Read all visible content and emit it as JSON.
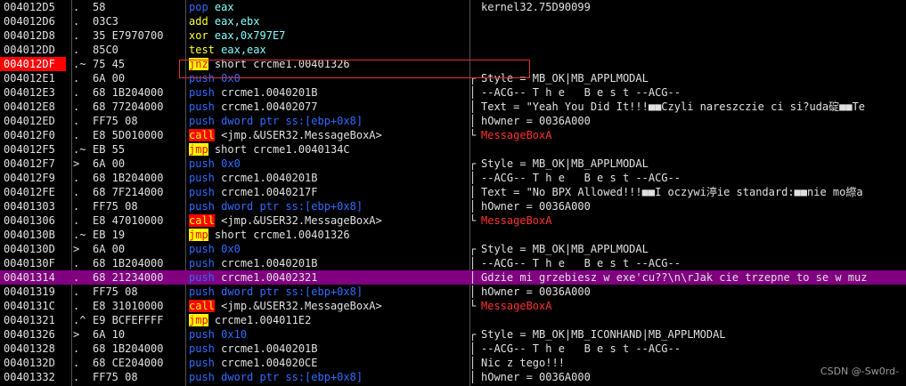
{
  "rows": [
    {
      "addr": "004012D5",
      "arr": ".",
      "hex": "58",
      "m": "pop",
      "o": "eax",
      "c": "kernel32.75D90099"
    },
    {
      "addr": "004012D6",
      "arr": ".",
      "hex": "03C3",
      "m": "add",
      "o": "eax,ebx",
      "c": ""
    },
    {
      "addr": "004012D8",
      "arr": ".",
      "hex": "35 E7970700",
      "m": "xor",
      "o": "eax,0x797E7",
      "c": ""
    },
    {
      "addr": "004012DD",
      "arr": ".",
      "hex": "85C0",
      "m": "test",
      "o": "eax,eax",
      "c": ""
    },
    {
      "addr": "004012DF",
      "arr": ".~",
      "hex": "75 45",
      "m": "jnz",
      "o": "short crcme1.00401326",
      "c": ""
    },
    {
      "addr": "004012E1",
      "arr": ".",
      "hex": "6A 00",
      "m": "push",
      "o": "0x0",
      "c": "Style = MB_OK|MB_APPLMODAL"
    },
    {
      "addr": "004012E3",
      "arr": ".",
      "hex": "68 1B204000",
      "m": "push",
      "o": "crcme1.0040201B",
      "c": "--ACG-- T h e   B e s t --ACG--"
    },
    {
      "addr": "004012E8",
      "arr": ".",
      "hex": "68 77204000",
      "m": "push",
      "o": "crcme1.00402077",
      "c": "Text = \"Yeah You Did It!!!■■Czyli nareszczie ci si?uda碇■■Te"
    },
    {
      "addr": "004012ED",
      "arr": ".",
      "hex": "FF75 08",
      "m": "push",
      "o": "dword ptr ss:[ebp+0x8]",
      "c": "hOwner = 0036A000"
    },
    {
      "addr": "004012F0",
      "arr": ".",
      "hex": "E8 5D010000",
      "m": "call",
      "o": "<jmp.&USER32.MessageBoxA>",
      "c": "MessageBoxA"
    },
    {
      "addr": "004012F5",
      "arr": ".~",
      "hex": "EB 55",
      "m": "jmp",
      "o": "short crcme1.0040134C",
      "c": ""
    },
    {
      "addr": "004012F7",
      "arr": ">",
      "hex": "6A 00",
      "m": "push",
      "o": "0x0",
      "c": "Style = MB_OK|MB_APPLMODAL"
    },
    {
      "addr": "004012F9",
      "arr": ".",
      "hex": "68 1B204000",
      "m": "push",
      "o": "crcme1.0040201B",
      "c": "--ACG-- T h e   B e s t --ACG--"
    },
    {
      "addr": "004012FE",
      "arr": ".",
      "hex": "68 7F214000",
      "m": "push",
      "o": "crcme1.0040217F",
      "c": "Text = \"No BPX Allowed!!!■■I oczywi渟ie standard:■■nie mo縩a"
    },
    {
      "addr": "00401303",
      "arr": ".",
      "hex": "FF75 08",
      "m": "push",
      "o": "dword ptr ss:[ebp+0x8]",
      "c": "hOwner = 0036A000"
    },
    {
      "addr": "00401306",
      "arr": ".",
      "hex": "E8 47010000",
      "m": "call",
      "o": "<jmp.&USER32.MessageBoxA>",
      "c": "MessageBoxA"
    },
    {
      "addr": "0040130B",
      "arr": ".~",
      "hex": "EB 19",
      "m": "jmp",
      "o": "short crcme1.00401326",
      "c": ""
    },
    {
      "addr": "0040130D",
      "arr": ">",
      "hex": "6A 00",
      "m": "push",
      "o": "0x0",
      "c": "Style = MB_OK|MB_APPLMODAL"
    },
    {
      "addr": "0040130F",
      "arr": ".",
      "hex": "68 1B204000",
      "m": "push",
      "o": "crcme1.0040201B",
      "c": "--ACG-- T h e   B e s t --ACG--"
    },
    {
      "addr": "00401314",
      "arr": ".",
      "hex": "68 21234000",
      "m": "push",
      "o": "crcme1.00402321",
      "c": "Gdzie mi grzebiesz w exe'cu??\\n\\rJak cie trzepne to se w muz"
    },
    {
      "addr": "00401319",
      "arr": ".",
      "hex": "FF75 08",
      "m": "push",
      "o": "dword ptr ss:[ebp+0x8]",
      "c": "hOwner = 0036A000"
    },
    {
      "addr": "0040131C",
      "arr": ".",
      "hex": "E8 31010000",
      "m": "call",
      "o": "<jmp.&USER32.MessageBoxA>",
      "c": "MessageBoxA"
    },
    {
      "addr": "00401321",
      "arr": ".^",
      "hex": "E9 BCFEFFFF",
      "m": "jmp",
      "o": "crcme1.004011E2",
      "c": ""
    },
    {
      "addr": "00401326",
      "arr": ">",
      "hex": "6A 10",
      "m": "push",
      "o": "0x10",
      "c": "Style = MB_OK|MB_ICONHAND|MB_APPLMODAL"
    },
    {
      "addr": "00401328",
      "arr": ".",
      "hex": "68 1B204000",
      "m": "push",
      "o": "crcme1.0040201B",
      "c": "--ACG-- T h e   B e s t --ACG--"
    },
    {
      "addr": "0040132D",
      "arr": ".",
      "hex": "68 CE204000",
      "m": "push",
      "o": "crcme1.004020CE",
      "c": "Nic z tego!!!"
    },
    {
      "addr": "00401332",
      "arr": ".",
      "hex": "FF75 08",
      "m": "push",
      "o": "dword ptr ss:[ebp+0x8]",
      "c": "hOwner = 0036A000"
    }
  ],
  "watermark": "CSDN @-Sw0rd-",
  "colors": {
    "selected_row": "#800080",
    "current_address": "#ff0000",
    "push": "#2d6cff",
    "call_bg": "#ff0000",
    "jmp_bg": "#ffff00"
  }
}
